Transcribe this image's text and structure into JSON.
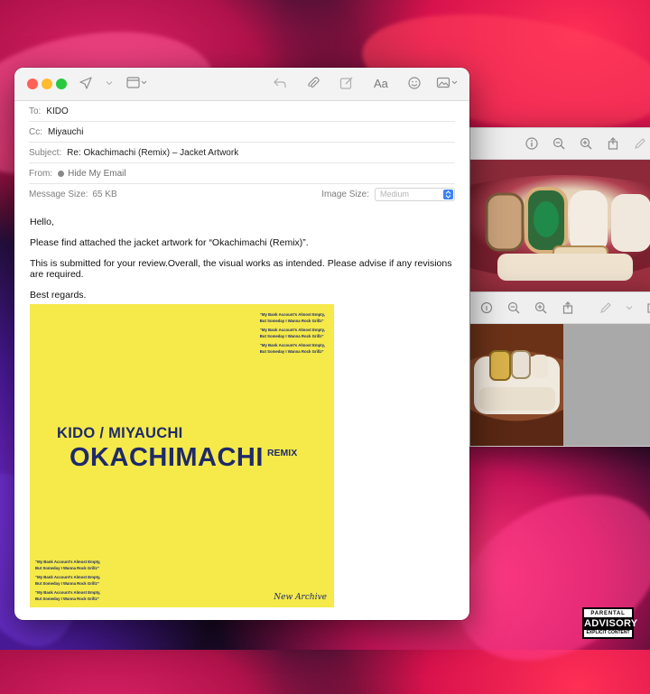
{
  "mail": {
    "to_label": "To:",
    "to_value": "KIDO",
    "cc_label": "Cc:",
    "cc_value": "Miyauchi",
    "subject_label": "Subject:",
    "subject_value": "Re: Okachimachi (Remix) – Jacket Artwork",
    "from_label": "From:",
    "from_value": "Hide My Email",
    "size_label": "Message Size:",
    "size_value": "65 KB",
    "image_size_label": "Image Size:",
    "image_size_value": "Medium",
    "greeting": "Hello,",
    "line1": "Please find attached the jacket artwork for “Okachimachi (Remix)”.",
    "line2": "This is submitted for your review.Overall, the visual works as intended. Please advise if any revisions are required.",
    "signoff": "Best regards.",
    "toolbar": {
      "format_label": "Aa"
    }
  },
  "artwork": {
    "artist": "KIDO / MIYAUCHI",
    "title": "OKACHIMACHI",
    "remix": "REMIX",
    "quote_line1": "“My Bank Account’s Almost Empty,",
    "quote_line2": "But Someday I Wanna Rock Grillz”",
    "label_script": "New Archive"
  },
  "advisory": {
    "top": "PARENTAL",
    "main": "ADVISORY",
    "bottom": "EXPLICIT CONTENT"
  },
  "colors": {
    "artwork_bg": "#f5ea4a",
    "artwork_text": "#1f2a6a",
    "accent_blue": "#3b82f6"
  }
}
